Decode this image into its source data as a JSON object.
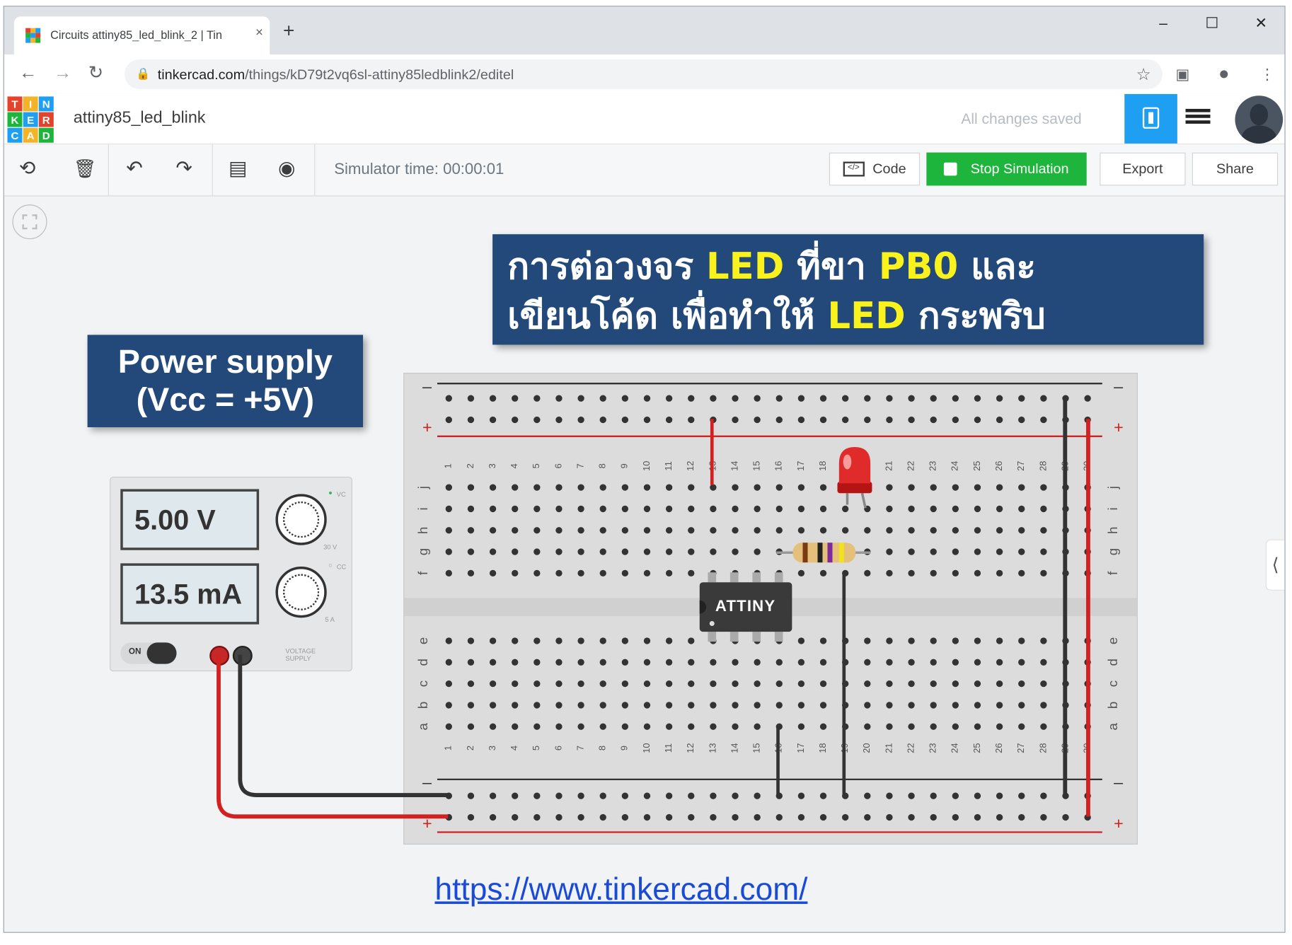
{
  "browser": {
    "tab_title": "Circuits attiny85_led_blink_2 | Tin",
    "tab_close": "×",
    "new_tab": "+",
    "url_host": "tinkercad.com",
    "url_path": "/things/kD79t2vq6sl-attiny85ledblink2/editel",
    "window_controls": {
      "minimize": "–",
      "maximize": "☐",
      "close": "✕"
    },
    "nav": {
      "back": "←",
      "forward": "→",
      "reload": "↻"
    }
  },
  "app": {
    "logo_letters": [
      "T",
      "I",
      "N",
      "K",
      "E",
      "R",
      "C",
      "A",
      "D"
    ],
    "logo_colors": [
      "#e2432a",
      "#f4b428",
      "#1e9ff2",
      "#1eb53c",
      "#1e9ff2",
      "#e2432a",
      "#1e9ff2",
      "#f4b428",
      "#1eb53c"
    ],
    "project_name": "attiny85_led_blink",
    "save_status": "All changes saved",
    "accent_color": "#1e9ff2"
  },
  "toolbar": {
    "tools": [
      {
        "name": "rotate-icon",
        "glyph": "⟲"
      },
      {
        "name": "trash-icon",
        "glyph": "🗑"
      },
      {
        "name": "undo-icon",
        "glyph": "↶"
      },
      {
        "name": "redo-icon",
        "glyph": "↷"
      },
      {
        "name": "notes-icon",
        "glyph": "▤"
      },
      {
        "name": "eye-icon",
        "glyph": "◉"
      }
    ],
    "sim_time": "Simulator time: 00:00:01",
    "code_label": "Code",
    "stop_label": "Stop Simulation",
    "export_label": "Export",
    "share_label": "Share",
    "sim_color": "#1eb53c"
  },
  "annotations": {
    "power_supply_line1": "Power supply",
    "power_supply_line2": "(Vcc = +5V)",
    "thai_l1_a": "การต่อวงจร ",
    "thai_l1_b": "LED",
    "thai_l1_c": " ที่ขา ",
    "thai_l1_d": "PB0",
    "thai_l1_e": " และ",
    "thai_l2_a": "เขียนโค้ด เพื่อทำให้ ",
    "thai_l2_b": "LED",
    "thai_l2_c": " กระพริบ",
    "link": "https://www.tinkercad.com/"
  },
  "power_supply": {
    "voltage": "5.00 V",
    "current": "13.5 mA",
    "switch_label": "ON",
    "knob1_label_max": "30 V",
    "knob2_label_max": "5 A",
    "vc_label": "VC",
    "cc_label": "CC",
    "brand": "VOLTAGE SUPPLY"
  },
  "breadboard": {
    "columns": [
      "1",
      "2",
      "3",
      "4",
      "5",
      "6",
      "7",
      "8",
      "9",
      "10",
      "11",
      "12",
      "13",
      "14",
      "15",
      "16",
      "17",
      "18",
      "19",
      "20",
      "21",
      "22",
      "23",
      "24",
      "25",
      "26",
      "27",
      "28",
      "29",
      "30"
    ],
    "rows_top": [
      "j",
      "i",
      "h",
      "g",
      "f"
    ],
    "rows_bottom": [
      "e",
      "d",
      "c",
      "b",
      "a"
    ],
    "rail_minus": "–",
    "rail_plus": "+",
    "chip_label": "ATTINY"
  }
}
